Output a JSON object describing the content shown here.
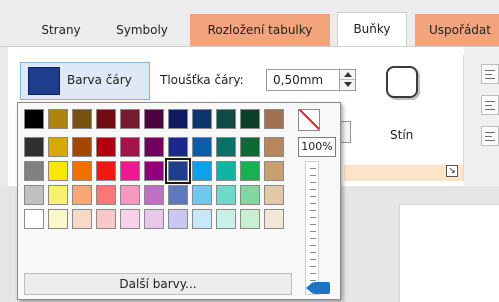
{
  "tabs": [
    {
      "label": "Strany",
      "style": "plain"
    },
    {
      "label": "Symboly",
      "style": "plain"
    },
    {
      "label": "Rozložení tabulky",
      "style": "orange"
    },
    {
      "label": "Buňky",
      "style": "active"
    },
    {
      "label": "Uspořádat",
      "style": "orange"
    }
  ],
  "ribbon": {
    "line_color": {
      "label": "Barva čáry",
      "color": "#1f3d8f"
    },
    "line_thickness": {
      "label": "Tloušťka čáry:",
      "value": "0,50mm"
    },
    "shadow": {
      "label": "Stín",
      "icon": "shadow-shape-icon"
    },
    "dialog_launcher_icon": "dialog-launcher-icon",
    "group_accent": "#fde4c8"
  },
  "color_picker": {
    "swatches": [
      [
        "#000000",
        "#b08214",
        "#7a4f12",
        "#6e0c10",
        "#741b2d",
        "#4d003d",
        "#101a60",
        "#0d3670",
        "#0f4a45",
        "#0b4026",
        "#a07050"
      ],
      [
        "#2f2f2f",
        "#d8a800",
        "#a24800",
        "#b00010",
        "#a0164a",
        "#70005b",
        "#1a2a88",
        "#0d5ea8",
        "#0c7066",
        "#0c6a35",
        "#b8865c"
      ],
      [
        "#808080",
        "#f8e800",
        "#f07000",
        "#f01810",
        "#f01890",
        "#90007a",
        "#1f3d8f",
        "#10a0e8",
        "#10b4a0",
        "#18b050",
        "#c8a070"
      ],
      [
        "#c0c0c0",
        "#f8f070",
        "#f8a870",
        "#f87878",
        "#f898c0",
        "#c070c0",
        "#6078c0",
        "#70c8f0",
        "#70d8c8",
        "#80d8a0",
        "#e0c8a8"
      ],
      [
        "#ffffff",
        "#f8f8c8",
        "#f8d8c8",
        "#f8c8c8",
        "#f8d0e8",
        "#e8c8e8",
        "#c8c8f0",
        "#c8e8f8",
        "#c8f0e8",
        "#c8f0d0",
        "#f0e8d8"
      ]
    ],
    "selected": {
      "row": 2,
      "col": 6
    },
    "more_colors_label": "Další barvy...",
    "no_color_icon": "no-color-icon",
    "opacity": {
      "label": "100%",
      "value_percent": 100
    },
    "slider_thumb_color": "#1f73c5"
  }
}
